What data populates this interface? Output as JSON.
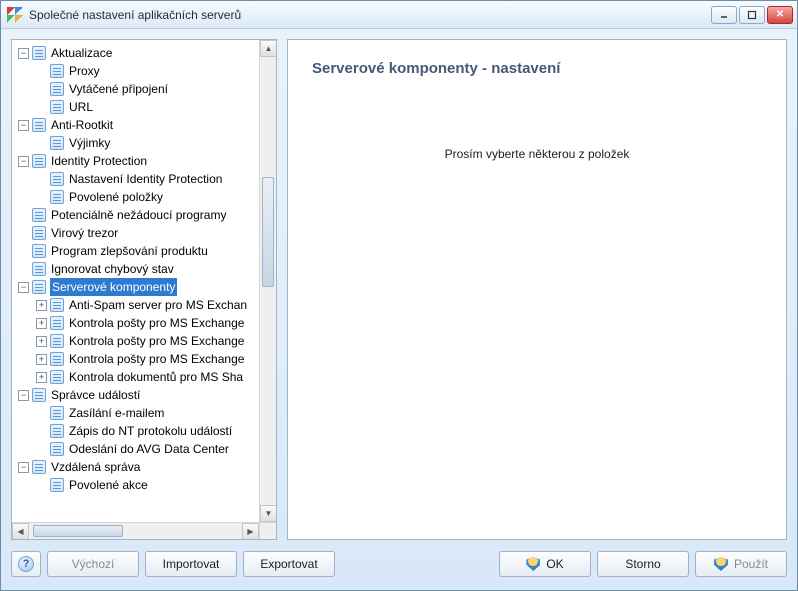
{
  "window": {
    "title": "Společné nastavení aplikačních serverů"
  },
  "tree": {
    "aktualizace": {
      "label": "Aktualizace",
      "proxy": "Proxy",
      "vytacene": "Vytáčené připojení",
      "url": "URL"
    },
    "antirootkit": {
      "label": "Anti-Rootkit",
      "vyjimky": "Výjimky"
    },
    "idp": {
      "label": "Identity Protection",
      "nastaveni": "Nastavení Identity Protection",
      "povolene": "Povolené položky"
    },
    "pup": "Potenciálně nežádoucí programy",
    "trezor": "Virový trezor",
    "pzp": "Program zlepšování produktu",
    "chybovy": "Ignorovat chybový stav",
    "serverove": {
      "label": "Serverové komponenty",
      "antispam": "Anti-Spam server pro MS Exchan",
      "kontrola1": "Kontrola pošty pro MS Exchange",
      "kontrola2": "Kontrola pošty pro MS Exchange",
      "kontrola3": "Kontrola pošty pro MS Exchange",
      "dokumenty": "Kontrola dokumentů pro MS Sha"
    },
    "spravce": {
      "label": "Správce událostí",
      "email": "Zasílání e-mailem",
      "nt": "Zápis do NT protokolu událostí",
      "avg": "Odeslání do AVG Data Center"
    },
    "vzdalena": {
      "label": "Vzdálená správa",
      "akce": "Povolené akce"
    }
  },
  "detail": {
    "title": "Serverové komponenty - nastavení",
    "message": "Prosím vyberte některou z položek"
  },
  "buttons": {
    "help": "?",
    "vychozi": "Výchozí",
    "importovat": "Importovat",
    "exportovat": "Exportovat",
    "ok": "OK",
    "storno": "Storno",
    "pouzit": "Použít"
  }
}
